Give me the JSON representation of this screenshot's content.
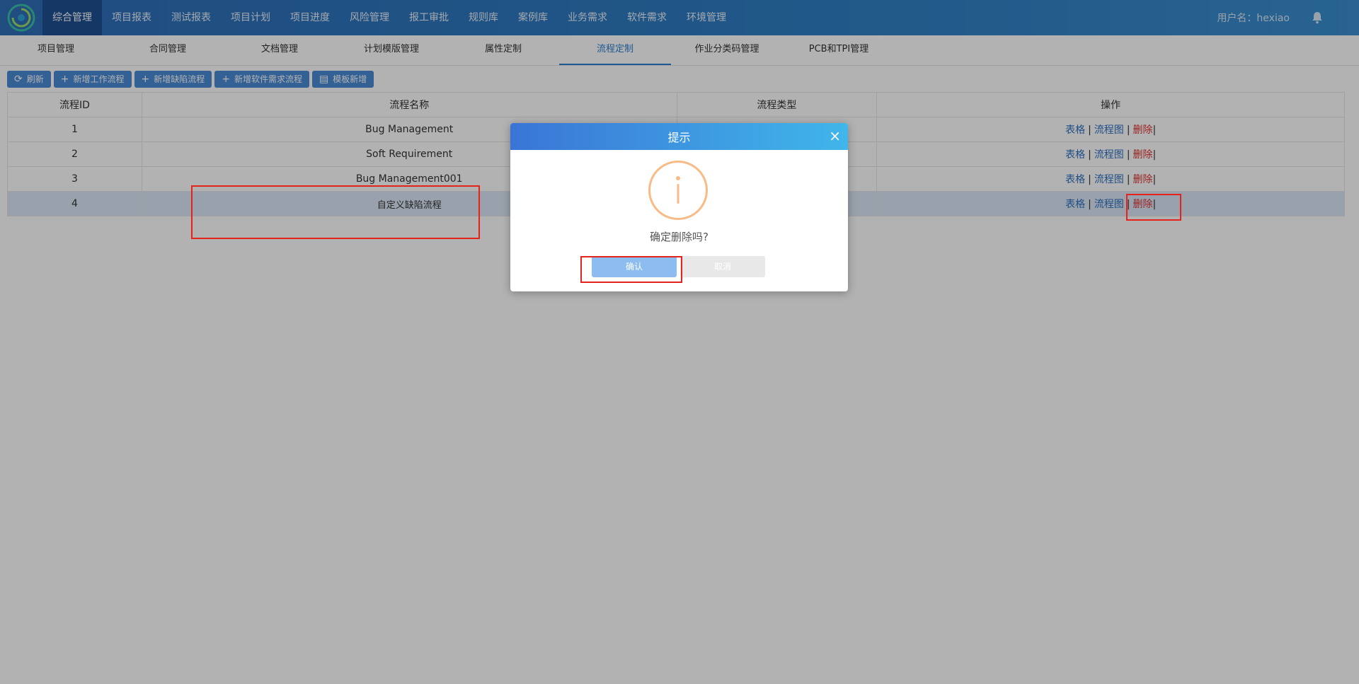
{
  "topnav": {
    "items": [
      "综合管理",
      "项目报表",
      "测试报表",
      "项目计划",
      "项目进度",
      "风险管理",
      "报工审批",
      "规则库",
      "案例库",
      "业务需求",
      "软件需求",
      "环境管理"
    ],
    "user_label": "用户名：hexiao"
  },
  "subnav": {
    "items": [
      "项目管理",
      "合同管理",
      "文档管理",
      "计划模版管理",
      "属性定制",
      "流程定制",
      "作业分类码管理",
      "PCB和TPI管理"
    ]
  },
  "toolbar": {
    "refresh": "刷新",
    "add_workflow": "新增工作流程",
    "add_defect_flow": "新增缺陷流程",
    "add_software_req_flow": "新增软件需求流程",
    "template_add": "模板新增"
  },
  "table": {
    "headers": [
      "流程ID",
      "流程名称",
      "流程类型",
      "操作"
    ],
    "rows": [
      {
        "id": "1",
        "name": "Bug Management",
        "type": ""
      },
      {
        "id": "2",
        "name": "Soft Requirement",
        "type": ""
      },
      {
        "id": "3",
        "name": "Bug Management001",
        "type": ""
      },
      {
        "id": "4",
        "name": "自定义缺陷流程",
        "type": ""
      }
    ],
    "ops": {
      "form": "表格",
      "flowchart": "流程图",
      "delete": "删除",
      "sep": "|"
    }
  },
  "dialog": {
    "title": "提示",
    "close": "×",
    "message": "确定删除吗?",
    "confirm": "确认",
    "cancel": "取消"
  },
  "colors": {
    "brand": "#2f6db8",
    "link": "#2d6fc0",
    "danger": "#d33",
    "annotation": "#e5231b"
  }
}
